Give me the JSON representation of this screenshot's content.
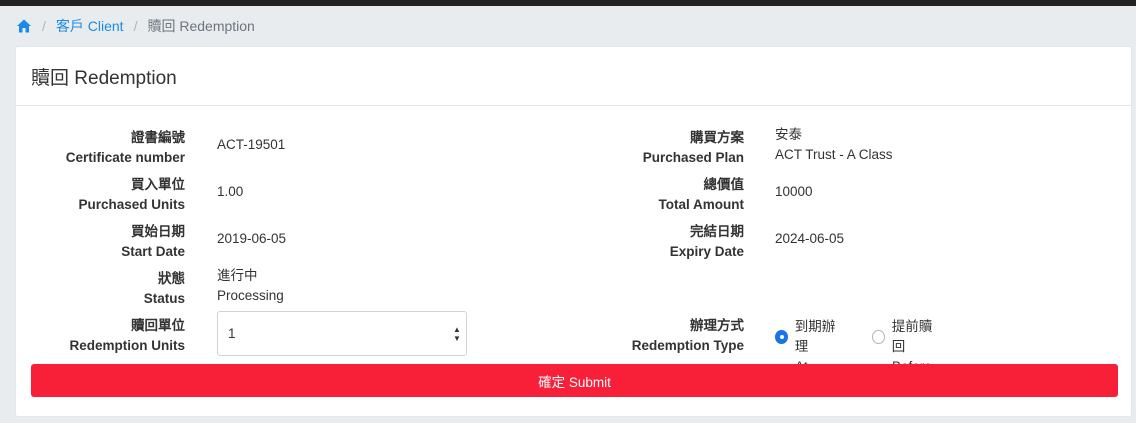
{
  "breadcrumb": {
    "home_icon": "home-icon",
    "items": [
      "客戶 Client",
      "贖回 Redemption"
    ],
    "separator": "/"
  },
  "card": {
    "title": "贖回 Redemption"
  },
  "fields": {
    "certificate": {
      "zh": "證書編號",
      "en": "Certificate number",
      "value": "ACT-19501"
    },
    "plan": {
      "zh": "購買方案",
      "en": "Purchased Plan",
      "value_zh": "安泰",
      "value_en": "ACT Trust - A Class"
    },
    "units": {
      "zh": "買入單位",
      "en": "Purchased Units",
      "value": "1.00"
    },
    "total": {
      "zh": "總價值",
      "en": "Total Amount",
      "value": "10000"
    },
    "start": {
      "zh": "買始日期",
      "en": "Start Date",
      "value": "2019-06-05"
    },
    "expiry": {
      "zh": "完結日期",
      "en": "Expiry Date",
      "value": "2024-06-05"
    },
    "status": {
      "zh": "狀態",
      "en": "Status",
      "value_zh": "進行中",
      "value_en": "Processing"
    },
    "redemption_units": {
      "zh": "贖回單位",
      "en": "Redemption Units",
      "value": "1"
    },
    "redemption_type": {
      "zh": "辦理方式",
      "en": "Redemption Type",
      "options": [
        {
          "zh": "到期辦理",
          "en": "At Maturity",
          "checked": true
        },
        {
          "zh": "提前贖回",
          "en": "Before Maturity",
          "checked": false
        }
      ]
    }
  },
  "submit_label": "確定 Submit",
  "colors": {
    "accent": "#1a8be6",
    "submit": "#f81f38",
    "radio": "#1a73e8"
  }
}
